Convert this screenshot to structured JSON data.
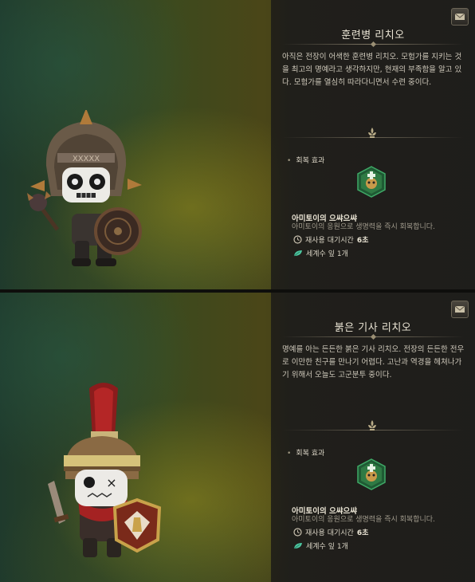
{
  "cards": [
    {
      "title": "훈련병 리치오",
      "description": "아직은 전장이 어색한 훈련병 리치오. 모험가를 지키는 것을 최고의 명예라고 생각하지만, 현재의 부족함을 알고 있다. 모험가를 열심히 따라다니면서 수련 중이다.",
      "section_label": "회복 효과",
      "skill_name": "아미토이의 으쌰으쌰",
      "skill_desc": "아미토이의 응원으로 생명력을 즉시 회복합니다.",
      "cooldown_label": "재사용 대기시간",
      "cooldown_value": "6초",
      "item_label": "세계수 잎 1개"
    },
    {
      "title": "붉은 기사 리치오",
      "description": "명예를 아는 든든한 붉은 기사 리치오. 전장의 든든한 전우로 이만한 친구를 만나기 어렵다. 고난과 역경을 헤쳐나가기 위해서 오늘도 고군분투 중이다.",
      "section_label": "회복 효과",
      "skill_name": "아미토이의 으쌰으쌰",
      "skill_desc": "아미토이의 응원으로 생명력을 즉시 회복합니다.",
      "cooldown_label": "재사용 대기시간",
      "cooldown_value": "6초",
      "item_label": "세계수 잎 1개"
    }
  ],
  "icons": {
    "corner": "mail-scroll-icon",
    "divider": "fleur-de-lis-icon",
    "skill": "healing-cross-hex-icon",
    "cooldown": "clock-icon",
    "item": "leaf-icon"
  },
  "colors": {
    "accent_green": "#2f8a4c",
    "gold": "#c9a24a",
    "panel_bg": "#1e1d1b"
  }
}
